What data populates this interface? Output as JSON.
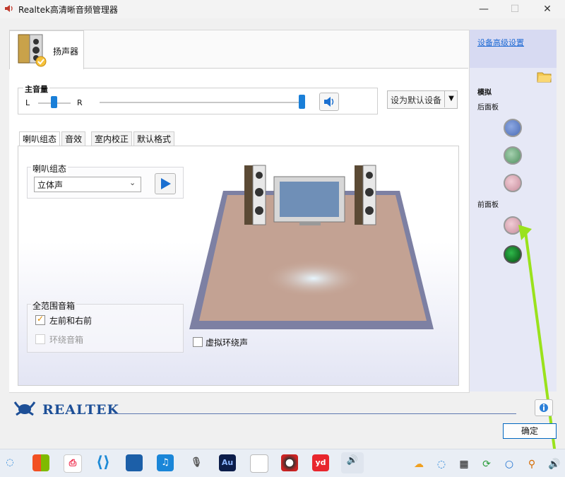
{
  "window": {
    "title": "Realtek高清晰音频管理器",
    "minimize": "—",
    "maximize": "☐",
    "close": "✕"
  },
  "device_tab": {
    "label": "扬声器",
    "icon": "speakers-icon"
  },
  "master_volume": {
    "label": "主音量",
    "left": "L",
    "right": "R",
    "balance_percent": 50,
    "volume_percent": 100
  },
  "default_device": {
    "label": "设为默认设备"
  },
  "inner_tabs": [
    "喇叭组态",
    "音效",
    "室内校正",
    "默认格式"
  ],
  "speaker_config": {
    "group_label": "喇叭组态",
    "selected": "立体声"
  },
  "fullrange": {
    "group_label": "全范围音箱",
    "front": {
      "label": "左前和右前",
      "checked": true
    },
    "surround": {
      "label": "环绕音箱",
      "checked": false
    }
  },
  "virtual_surround": {
    "label": "虚拟环绕声",
    "checked": false
  },
  "right_panel": {
    "advanced_link": "设备高级设置",
    "analog_label": "模拟",
    "rear_panel_label": "后面板",
    "front_panel_label": "前面板",
    "colors": {
      "blue": "#5b7fc8",
      "green": "#6aa67a",
      "pink": "#d9a4b2",
      "pink_front": "#d8a2b0",
      "green_active": "#0b7a1c"
    }
  },
  "brand": {
    "name": "REALTEK"
  },
  "ok_button": "确定",
  "accent": "#1a7fd8"
}
